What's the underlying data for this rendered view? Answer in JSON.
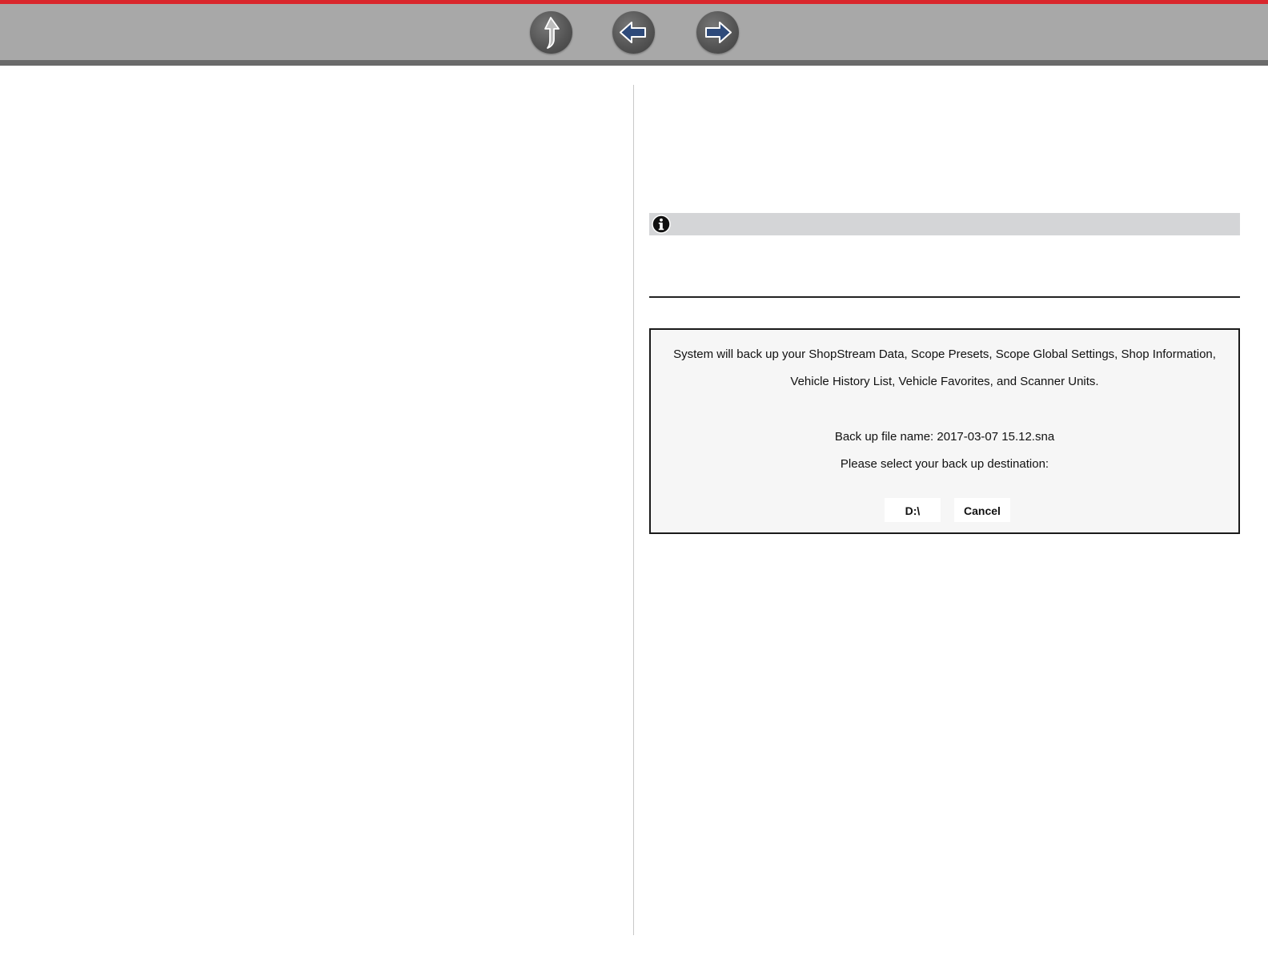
{
  "toolbar": {
    "buttons": [
      {
        "name": "up-icon"
      },
      {
        "name": "arrow-left-icon"
      },
      {
        "name": "arrow-right-icon"
      }
    ]
  },
  "note": {
    "icon": "info-icon"
  },
  "dialog": {
    "message_line1": "System will back up your ShopStream Data, Scope Presets, Scope Global Settings, Shop Information,",
    "message_line2": "Vehicle History List, Vehicle Favorites, and Scanner Units.",
    "filename_text": "Back up file name: 2017-03-07 15.12.sna",
    "prompt_text": "Please select your back up destination:",
    "drive_label": "D:\\",
    "cancel_label": "Cancel"
  },
  "colors": {
    "accent_red": "#d9262c",
    "toolbar_gray": "#a8a8a8",
    "arrow_blue": "#2e4a7a"
  }
}
